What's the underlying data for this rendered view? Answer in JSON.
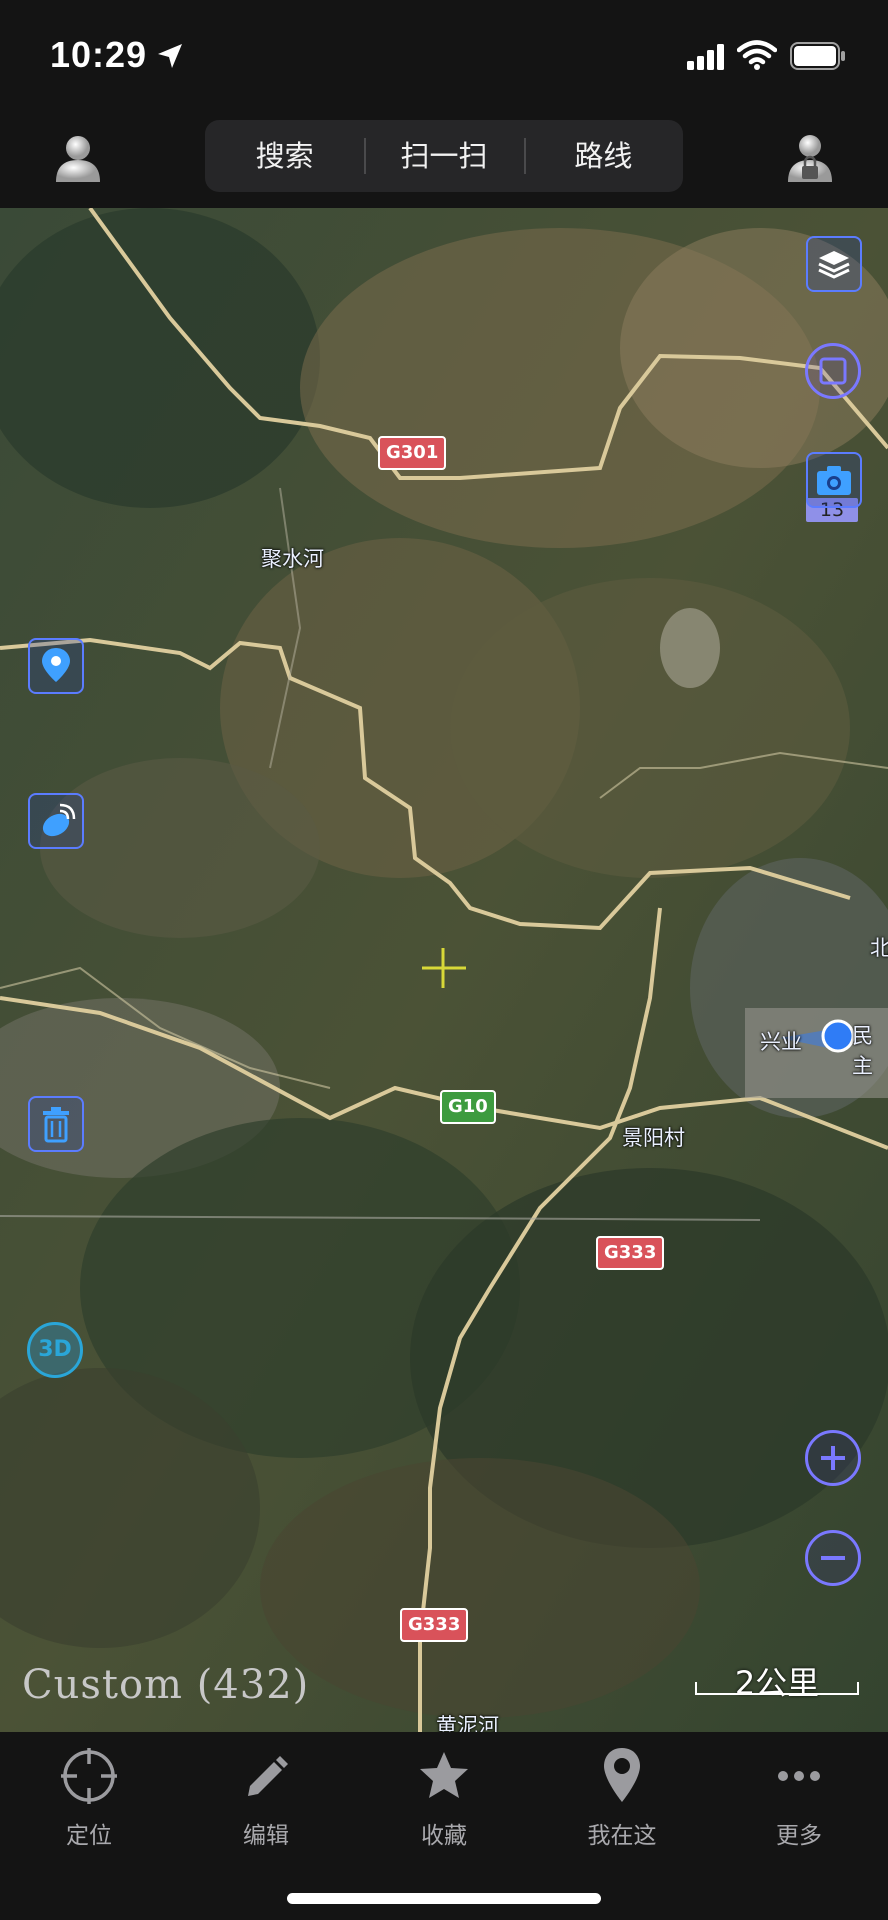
{
  "status_bar": {
    "time": "10:29"
  },
  "toolbar": {
    "tabs": [
      "搜索",
      "扫一扫",
      "路线"
    ]
  },
  "map": {
    "labels": {
      "river1": "聚水河",
      "village": "景阳村",
      "town": "兴业",
      "town2": "民主",
      "north": "北",
      "river2": "黄泥河"
    },
    "roads": {
      "g301": "G301",
      "g10": "G10",
      "g333a": "G333",
      "g333b": "G333"
    },
    "zoom_level": "13",
    "custom_label": "Custom (432)",
    "scale_text": "2公里",
    "icons": {
      "layers": "layers-icon",
      "square": "square-icon",
      "camera": "camera-icon",
      "pin": "location-pin-icon",
      "satellite": "satellite-icon",
      "trash": "trash-icon",
      "three_d": "3D",
      "zoom_in": "zoom-in-icon",
      "zoom_out": "zoom-out-icon"
    },
    "colors": {
      "control_border": "#5b7cff",
      "road_red": "#d9525a",
      "road_green": "#3d9b3f",
      "location_dot": "#2f7cf6"
    }
  },
  "bottom_nav": {
    "items": [
      {
        "label": "定位",
        "icon": "crosshair-icon"
      },
      {
        "label": "编辑",
        "icon": "pencil-icon"
      },
      {
        "label": "收藏",
        "icon": "star-icon"
      },
      {
        "label": "我在这",
        "icon": "map-pin-icon"
      },
      {
        "label": "更多",
        "icon": "more-dots-icon"
      }
    ]
  }
}
